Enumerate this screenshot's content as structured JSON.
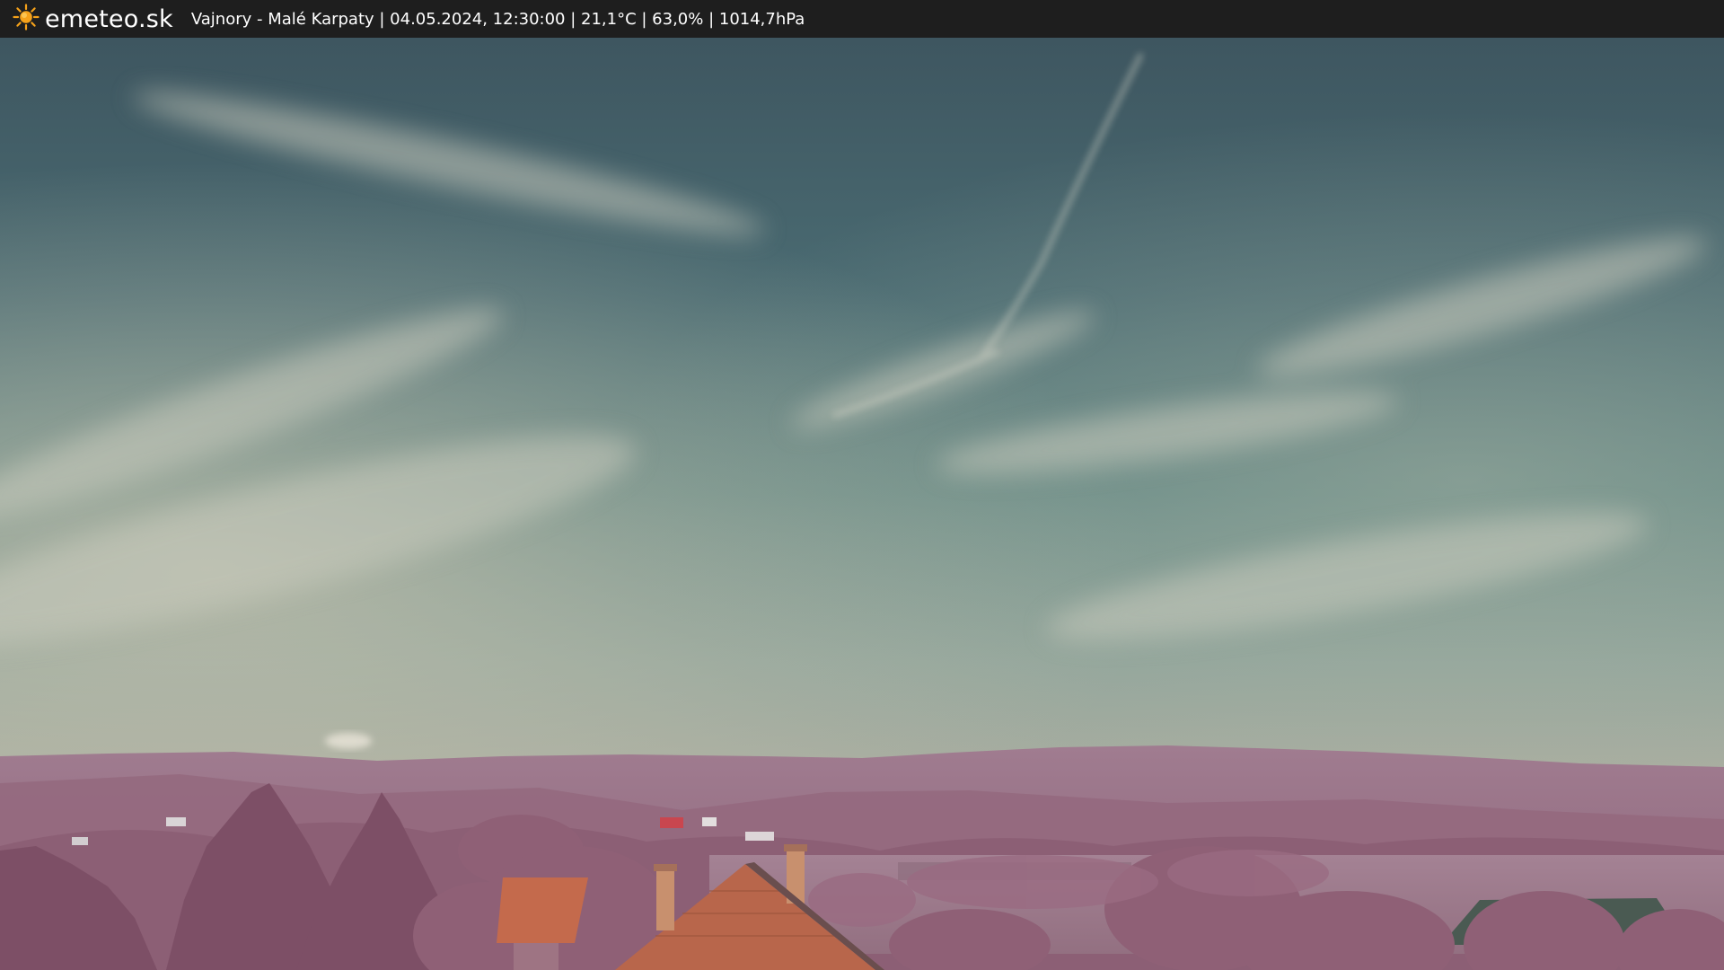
{
  "header": {
    "logo_text": "emeteo.sk",
    "logo_icon": "sun-icon",
    "caption": "Vajnory - Malé Karpaty | 04.05.2024, 12:30:00 | 21,1°C | 63,0% | 1014,7hPa"
  },
  "colors": {
    "bar_bg": "#1e1e1e",
    "sun": "#f6a21a",
    "sky_top": "#3d5560",
    "sky_mid": "#5c7b80",
    "sky_horizon": "#9ba79e",
    "hills": "#9a6e86",
    "foliage": "#8b5c72",
    "roof": "#c06a4e"
  }
}
